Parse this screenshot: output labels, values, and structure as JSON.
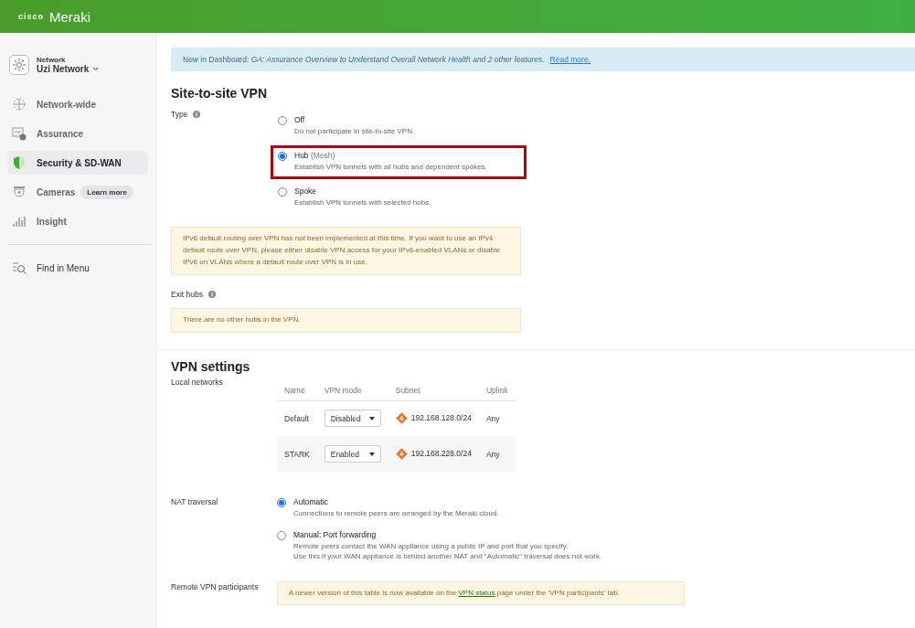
{
  "header": {
    "brand_mark": "cisco",
    "brand": "Meraki"
  },
  "sidebar": {
    "network": {
      "label": "Network",
      "name": "Uzi Network"
    },
    "items": [
      {
        "label": "Network-wide",
        "selected": false
      },
      {
        "label": "Assurance",
        "selected": false
      },
      {
        "label": "Security & SD-WAN",
        "selected": true
      },
      {
        "label": "Cameras",
        "selected": false,
        "badge": "Learn more"
      },
      {
        "label": "Insight",
        "selected": false
      }
    ],
    "find": "Find in Menu"
  },
  "banner": {
    "text": "New in Dashboard: *GA: Assurance Overview to Understand Overall Network Health and 2 other features.*",
    "link": "Read more."
  },
  "site_to_site": {
    "title": "Site-to-site VPN",
    "type_label": "Type",
    "options": [
      {
        "label": "Off",
        "description": "Do not participate in site-to-site VPN.",
        "selected": false,
        "highlighted": false
      },
      {
        "label": "Hub",
        "suffix": "(Mesh)",
        "description": "Establish VPN tunnels with all hubs and dependent spokes.",
        "selected": true,
        "highlighted": true
      },
      {
        "label": "Spoke",
        "description": "Establish VPN tunnels with selected hubs.",
        "selected": false,
        "highlighted": false
      }
    ],
    "ipv6_notice": "IPv6 default routing over VPN has not been implemented at this time. If you want to use an IPv4 default route over VPN, please either disable VPN access for your IPv6-enabled VLANs or disable IPv6 on VLANs where a default route over VPN is in use.",
    "exit_hubs_label": "Exit hubs",
    "exit_hubs_notice": "There are no other hubs in the VPN."
  },
  "vpn_settings": {
    "title": "VPN settings",
    "local_networks_label": "Local networks",
    "columns": [
      "Name",
      "VPN mode",
      "Subnet",
      "Uplink"
    ],
    "rows": [
      {
        "name": "Default",
        "mode": "Disabled",
        "badge": "4",
        "subnet": "192.168.128.0/24",
        "uplink": "Any"
      },
      {
        "name": "STARK",
        "mode": "Enabled",
        "badge": "4",
        "subnet": "192.168.228.0/24",
        "uplink": "Any"
      }
    ],
    "nat_label": "NAT traversal",
    "nat_options": [
      {
        "label": "Automatic",
        "description": [
          "Connections to remote peers are arranged by the Meraki cloud."
        ],
        "selected": true
      },
      {
        "label": "Manual: Port forwarding",
        "description": [
          "Remote peers contact the WAN appliance using a public IP and port that you specify.",
          "Use this if your WAN appliance is behind another NAT and \"Automatic\" traversal does not work."
        ],
        "selected": false
      }
    ],
    "remote_label": "Remote VPN participants",
    "remote_notice": {
      "before": "A newer version of this table is now available on the ",
      "link": "VPN status",
      "after": " page under the 'VPN participants' tab."
    }
  }
}
